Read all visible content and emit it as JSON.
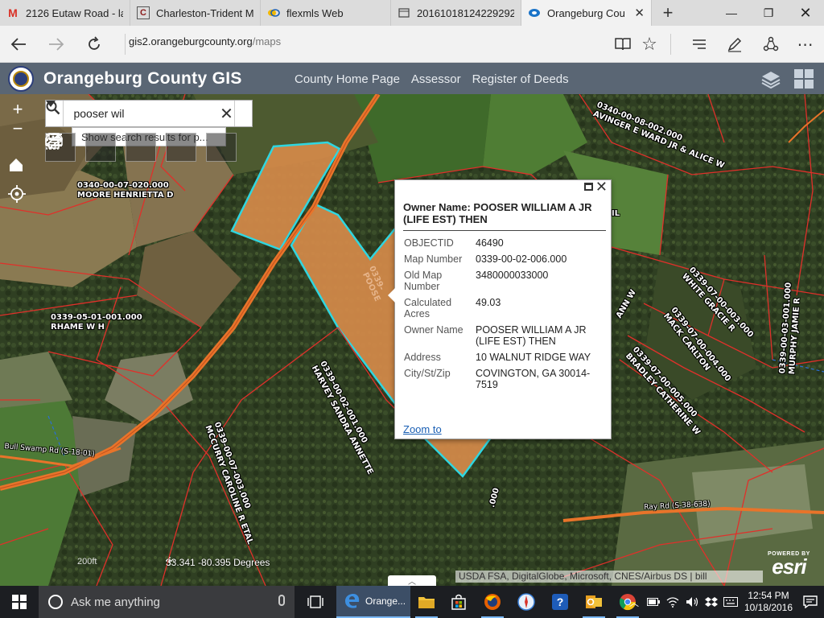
{
  "browser": {
    "tabs": [
      {
        "title": "2126 Eutaw Road - la",
        "icon": "gmail-icon",
        "active": false
      },
      {
        "title": "Charleston-Trident M",
        "icon": "cs-icon",
        "active": false
      },
      {
        "title": "flexmls Web",
        "icon": "flexmls-icon",
        "active": false
      },
      {
        "title": "20161018124229292.",
        "icon": "document-icon",
        "active": false
      },
      {
        "title": "Orangeburg Cou",
        "icon": "edge-tab-icon",
        "active": true
      }
    ],
    "new_tab": "+",
    "url_domain": "gis2.orangeburgcounty.org",
    "url_path": "/maps"
  },
  "header": {
    "title": "Orangeburg County GIS",
    "nav": [
      "County Home Page",
      "Assessor",
      "Register of Deeds"
    ]
  },
  "search": {
    "value": "pooser wil",
    "suggestion": "Show search results for p..."
  },
  "popup": {
    "title": "Owner Name: POOSER WILLIAM A JR (LIFE EST) THEN",
    "fields": [
      {
        "label": "OBJECTID",
        "value": "46490"
      },
      {
        "label": "Map Number",
        "value": "0339-00-02-006.000"
      },
      {
        "label": "Old Map Number",
        "value": "3480000033000"
      },
      {
        "label": "Calculated Acres",
        "value": "49.03"
      },
      {
        "label": "Owner Name",
        "value": "POOSER WILLIAM A JR (LIFE EST) THEN"
      },
      {
        "label": "Address",
        "value": "10 WALNUT RIDGE WAY"
      },
      {
        "label": "City/St/Zip",
        "value": "COVINGTON, GA 30014-7519"
      }
    ],
    "zoom_link": "Zoom to"
  },
  "map": {
    "labels": {
      "l1a": "0340-00-07-020.000",
      "l1b": "MOORE HENRIETTA D",
      "l2a": "0339-05-01-001.000",
      "l2b": "RHAME W H",
      "l3a": "0340-00-08-002.000",
      "l3b": "AVINGER E WARD JR & ALICE W",
      "l4a": "0339-00-02-001.000",
      "l4b": "HARVEY SANDRA ANNETTE",
      "l5a": "0339-00-07-003.000",
      "l5b": "MCCURRY CAROLINE R ETAL",
      "l6a": "0339-07-00-003.000",
      "l6b": "WHITE GRACIE R",
      "l7a": "0339-07-00-004.000",
      "l7b": "MACK CARLTON",
      "l8a": "0339-07-00-005.000",
      "l8b": "BRADLEY CATHERINE W",
      "l9a": "0339-00-03-001.000",
      "l9b": "MURPHY JAMIE R",
      "l10": ".000",
      "l11": "0339-",
      "l12": "POOSE",
      "l13": "Bull Swamp Rd (S-18-01)",
      "l14": "Ray Rd (S-38-638)",
      "l15": "IL",
      "l16": "ANN W"
    },
    "coords": "33.341 -80.395 Degrees",
    "scale": "200ft",
    "attribution": "USDA FSA, DigitalGlobe, Microsoft, CNES/Airbus DS | bill",
    "esri_powered": "POWERED BY",
    "esri": "esri"
  },
  "taskbar": {
    "search_placeholder": "Ask me anything",
    "edge_label": "Orange...",
    "time": "12:54 PM",
    "date": "10/18/2016"
  },
  "colors": {
    "parcel_fill": "#d58a4a",
    "parcel_outline": "#2fd6e0",
    "parcel_line": "#e0302a",
    "road": "#e8742a",
    "header": "#5a6674"
  }
}
